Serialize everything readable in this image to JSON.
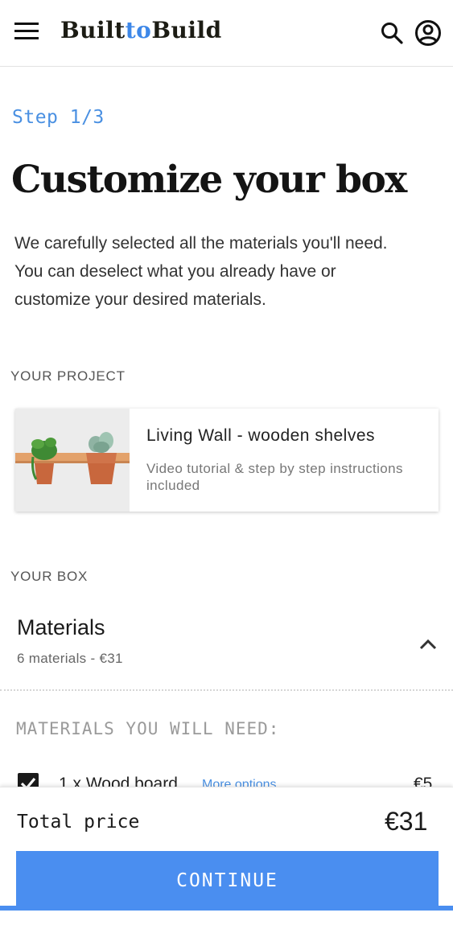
{
  "header": {
    "logo_part1": "Built",
    "logo_part2": "to",
    "logo_part3": "Build",
    "icons": [
      "menu-icon",
      "search-icon",
      "user-icon"
    ]
  },
  "step": "Step 1/3",
  "title": "Customize your box",
  "intro": "We carefully selected all the materials you'll need. You can deselect what you already have or customize your desired materials.",
  "project": {
    "section_label": "YOUR PROJECT",
    "name": "Living Wall - wooden shelves",
    "description": "Video tutorial & step by step instructions included"
  },
  "box": {
    "section_label": "YOUR BOX",
    "materials_title": "Materials",
    "materials_summary": "6 materials - €31",
    "expanded": true,
    "need_label": "MATERIALS YOU WILL NEED:",
    "items": [
      {
        "label": "1 x Wood board",
        "link": "More options",
        "price": "€5",
        "checked": true
      }
    ]
  },
  "footer": {
    "total_label": "Total price",
    "total_value": "€31",
    "continue_label": "CONTINUE"
  },
  "colors": {
    "accent": "#4a8ef0",
    "step_blue": "#4a90e2",
    "text_dark": "#141414"
  }
}
